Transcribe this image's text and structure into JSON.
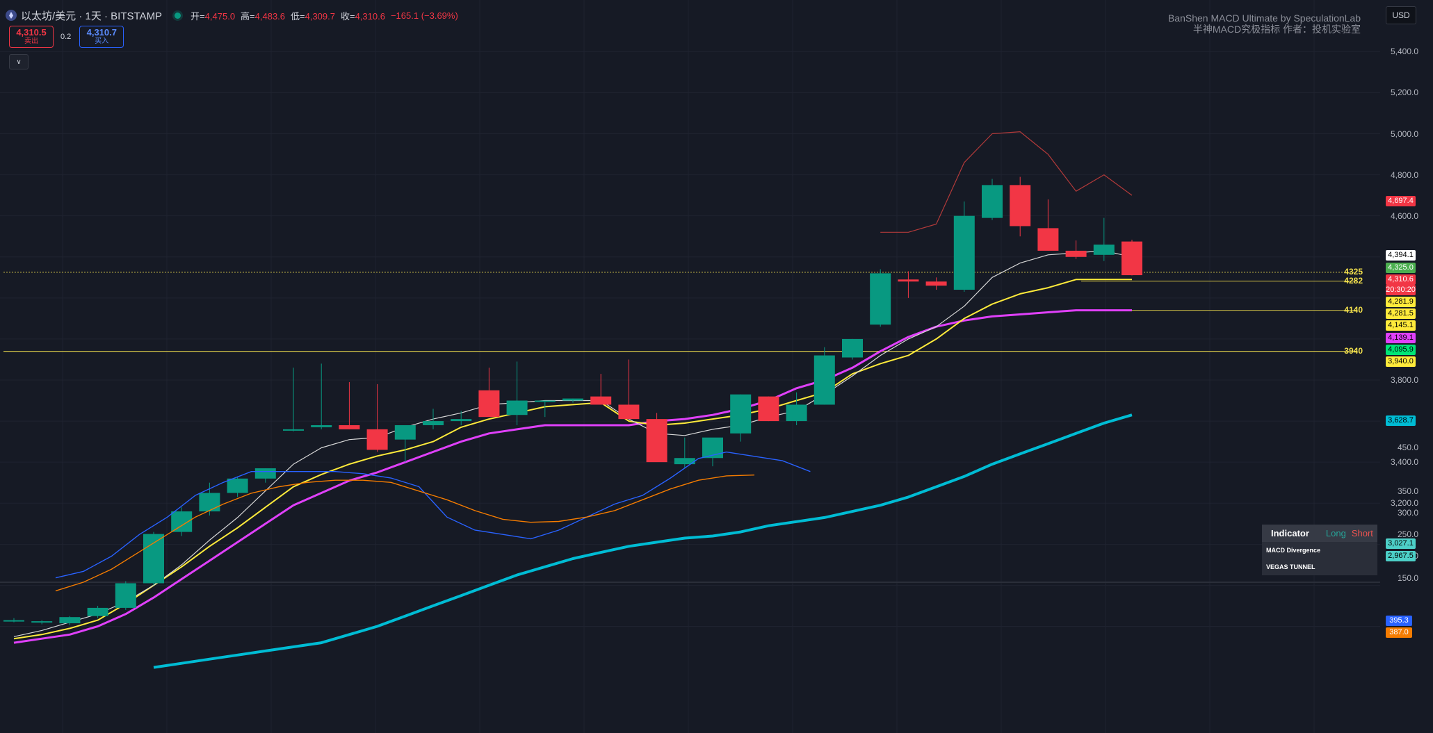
{
  "header": {
    "symbol": "以太坊/美元 · 1天 · BITSTAMP",
    "open_key": "开=",
    "open_val": "4,475.0",
    "high_key": "高=",
    "high_val": "4,483.6",
    "low_key": "低=",
    "low_val": "4,309.7",
    "close_key": "收=",
    "close_val": "4,310.6",
    "change": "−165.1 (−3.69%)"
  },
  "trade": {
    "sell_price": "4,310.5",
    "sell_label": "卖出",
    "spread": "0.2",
    "buy_price": "4,310.7",
    "buy_label": "买入"
  },
  "currency_button": "USD",
  "watermark": {
    "line1": "BanShen MACD Ultimate by SpeculationLab",
    "line2": "半神MACD究极指标 作者：投机实验室"
  },
  "price_axis": [
    "5,400.0",
    "5,200.0",
    "5,000.0",
    "4,800.0",
    "4,600.0",
    "3,800.0",
    "3,400.0",
    "3,200.0"
  ],
  "macd_axis": [
    "450.0",
    "350.0",
    "300.0",
    "250.0",
    "200.0",
    "150.0"
  ],
  "price_tags": [
    {
      "text": "4,697.4",
      "bg": "#f23645",
      "fg": "#ffffff"
    },
    {
      "text": "4,394.1",
      "bg": "#ffffff",
      "fg": "#000000"
    },
    {
      "text": "4,325.0",
      "bg": "#4caf50",
      "fg": "#ffffff"
    },
    {
      "text": "4,310.6",
      "bg": "#f23645",
      "fg": "#ffffff"
    },
    {
      "text": "20:30:20",
      "bg": "#f23645",
      "fg": "#ffffff"
    },
    {
      "text": "4,281.9",
      "bg": "#ffeb3b",
      "fg": "#000000"
    },
    {
      "text": "4,281.5",
      "bg": "#ffeb3b",
      "fg": "#000000"
    },
    {
      "text": "4,145.1",
      "bg": "#ffeb3b",
      "fg": "#000000"
    },
    {
      "text": "4,139.1",
      "bg": "#e040fb",
      "fg": "#000000"
    },
    {
      "text": "4,095.9",
      "bg": "#00e676",
      "fg": "#000000"
    },
    {
      "text": "3,940.0",
      "bg": "#ffeb3b",
      "fg": "#000000"
    },
    {
      "text": "3,628.7",
      "bg": "#00bcd4",
      "fg": "#000000"
    },
    {
      "text": "3,027.1",
      "bg": "#4dd0c8",
      "fg": "#000000"
    },
    {
      "text": "2,967.5",
      "bg": "#4dd0c8",
      "fg": "#000000"
    },
    {
      "text": "395.3",
      "bg": "#2962ff",
      "fg": "#ffffff"
    },
    {
      "text": "387.0",
      "bg": "#f57c00",
      "fg": "#ffffff"
    }
  ],
  "levels": [
    {
      "label": "4325",
      "price": 4325
    },
    {
      "label": "4282",
      "price": 4282
    },
    {
      "label": "4140",
      "price": 4140
    },
    {
      "label": "3940",
      "price": 3940
    }
  ],
  "legend": {
    "title": "Indicator",
    "long": "Long",
    "short": "Short",
    "row1": "MACD Divergence",
    "row2": "VEGAS TUNNEL"
  },
  "colors": {
    "up": "#089981",
    "down": "#f23645",
    "background": "#161a25",
    "ma_white": "#d8d8d8",
    "ma_yellow": "#ffeb3b",
    "ma_magenta": "#e040fb",
    "ma_cyan": "#00bcd4",
    "band_red": "#b23a3a",
    "macd_line": "#2962ff",
    "signal_line": "#f57c00"
  },
  "chart_data": {
    "type": "candlestick",
    "candles": [
      [
        2630,
        2640,
        2620,
        2630
      ],
      [
        2620,
        2630,
        2610,
        2625
      ],
      [
        2615,
        2650,
        2605,
        2645
      ],
      [
        2650,
        2700,
        2640,
        2690
      ],
      [
        2690,
        2820,
        2680,
        2810
      ],
      [
        2810,
        3060,
        2800,
        3050
      ],
      [
        3060,
        3180,
        3040,
        3160
      ],
      [
        3160,
        3300,
        3140,
        3250
      ],
      [
        3250,
        3330,
        3230,
        3320
      ],
      [
        3320,
        3370,
        3300,
        3370
      ],
      [
        3560,
        3860,
        3550,
        3560
      ],
      [
        3570,
        3880,
        3560,
        3580
      ],
      [
        3580,
        3790,
        3560,
        3560
      ],
      [
        3560,
        3780,
        3450,
        3460
      ],
      [
        3510,
        3540,
        3400,
        3580
      ],
      [
        3580,
        3660,
        3560,
        3600
      ],
      [
        3600,
        3650,
        3580,
        3610
      ],
      [
        3750,
        3860,
        3750,
        3620
      ],
      [
        3630,
        3890,
        3580,
        3700
      ],
      [
        3700,
        3700,
        3620,
        3700
      ],
      [
        3700,
        3710,
        3690,
        3710
      ],
      [
        3720,
        3830,
        3700,
        3680
      ],
      [
        3680,
        3900,
        3650,
        3610
      ],
      [
        3610,
        3640,
        3420,
        3400
      ],
      [
        3390,
        3520,
        3370,
        3420
      ],
      [
        3420,
        3500,
        3380,
        3520
      ],
      [
        3540,
        3730,
        3500,
        3730
      ],
      [
        3720,
        3720,
        3600,
        3600
      ],
      [
        3600,
        3740,
        3580,
        3680
      ],
      [
        3680,
        3960,
        3680,
        3920
      ],
      [
        3910,
        4000,
        3900,
        4000
      ],
      [
        4070,
        4340,
        4060,
        4320
      ],
      [
        4290,
        4330,
        4200,
        4280
      ],
      [
        4280,
        4300,
        4240,
        4260
      ],
      [
        4240,
        4670,
        4230,
        4600
      ],
      [
        4590,
        4780,
        4580,
        4750
      ],
      [
        4750,
        4790,
        4500,
        4550
      ],
      [
        4540,
        4680,
        4430,
        4430
      ],
      [
        4430,
        4480,
        4390,
        4400
      ],
      [
        4410,
        4590,
        4380,
        4460
      ],
      [
        4475,
        4484,
        4310,
        4311
      ]
    ],
    "ma_white": [
      2550,
      2580,
      2620,
      2660,
      2720,
      2800,
      2900,
      3020,
      3130,
      3260,
      3390,
      3470,
      3510,
      3520,
      3570,
      3610,
      3640,
      3680,
      3690,
      3700,
      3700,
      3700,
      3610,
      3540,
      3530,
      3560,
      3580,
      3620,
      3650,
      3730,
      3820,
      3920,
      4000,
      4060,
      4160,
      4300,
      4370,
      4410,
      4420,
      4430,
      4400
    ],
    "ma_yellow": [
      2540,
      2560,
      2590,
      2630,
      2710,
      2800,
      2890,
      2990,
      3080,
      3180,
      3280,
      3340,
      3390,
      3430,
      3460,
      3500,
      3570,
      3610,
      3640,
      3670,
      3680,
      3690,
      3600,
      3580,
      3590,
      3610,
      3630,
      3660,
      3700,
      3740,
      3830,
      3880,
      3920,
      4000,
      4100,
      4170,
      4220,
      4250,
      4290,
      4290,
      4290
    ],
    "ma_magenta": [
      2520,
      2540,
      2560,
      2600,
      2660,
      2740,
      2830,
      2920,
      3010,
      3100,
      3190,
      3250,
      3310,
      3350,
      3400,
      3450,
      3500,
      3540,
      3560,
      3580,
      3580,
      3580,
      3580,
      3600,
      3610,
      3630,
      3660,
      3700,
      3760,
      3800,
      3860,
      3940,
      4010,
      4060,
      4090,
      4110,
      4120,
      4130,
      4140,
      4140,
      4140
    ],
    "ma_cyan": [
      2400,
      2420,
      2440,
      2460,
      2480,
      2500,
      2520,
      2560,
      2600,
      2650,
      2700,
      2750,
      2800,
      2850,
      2890,
      2930,
      2960,
      2990,
      3010,
      3030,
      3040,
      3060,
      3090,
      3110,
      3130,
      3160,
      3190,
      3230,
      3280,
      3330,
      3390,
      3440,
      3490,
      3540,
      3590,
      3630
    ],
    "band_red": [
      4520,
      4520,
      4560,
      4860,
      5000,
      5010,
      4900,
      4720,
      4800,
      4700
    ],
    "macd": [
      150,
      165,
      200,
      250,
      290,
      340,
      370,
      395,
      395,
      395,
      395,
      390,
      380,
      360,
      290,
      260,
      250,
      240,
      260,
      290,
      320,
      340,
      380,
      425,
      440,
      430,
      420,
      395
    ],
    "signal": [
      120,
      140,
      170,
      210,
      250,
      290,
      320,
      345,
      360,
      370,
      375,
      375,
      370,
      350,
      330,
      305,
      285,
      278,
      280,
      290,
      305,
      330,
      355,
      375,
      385,
      387
    ]
  }
}
